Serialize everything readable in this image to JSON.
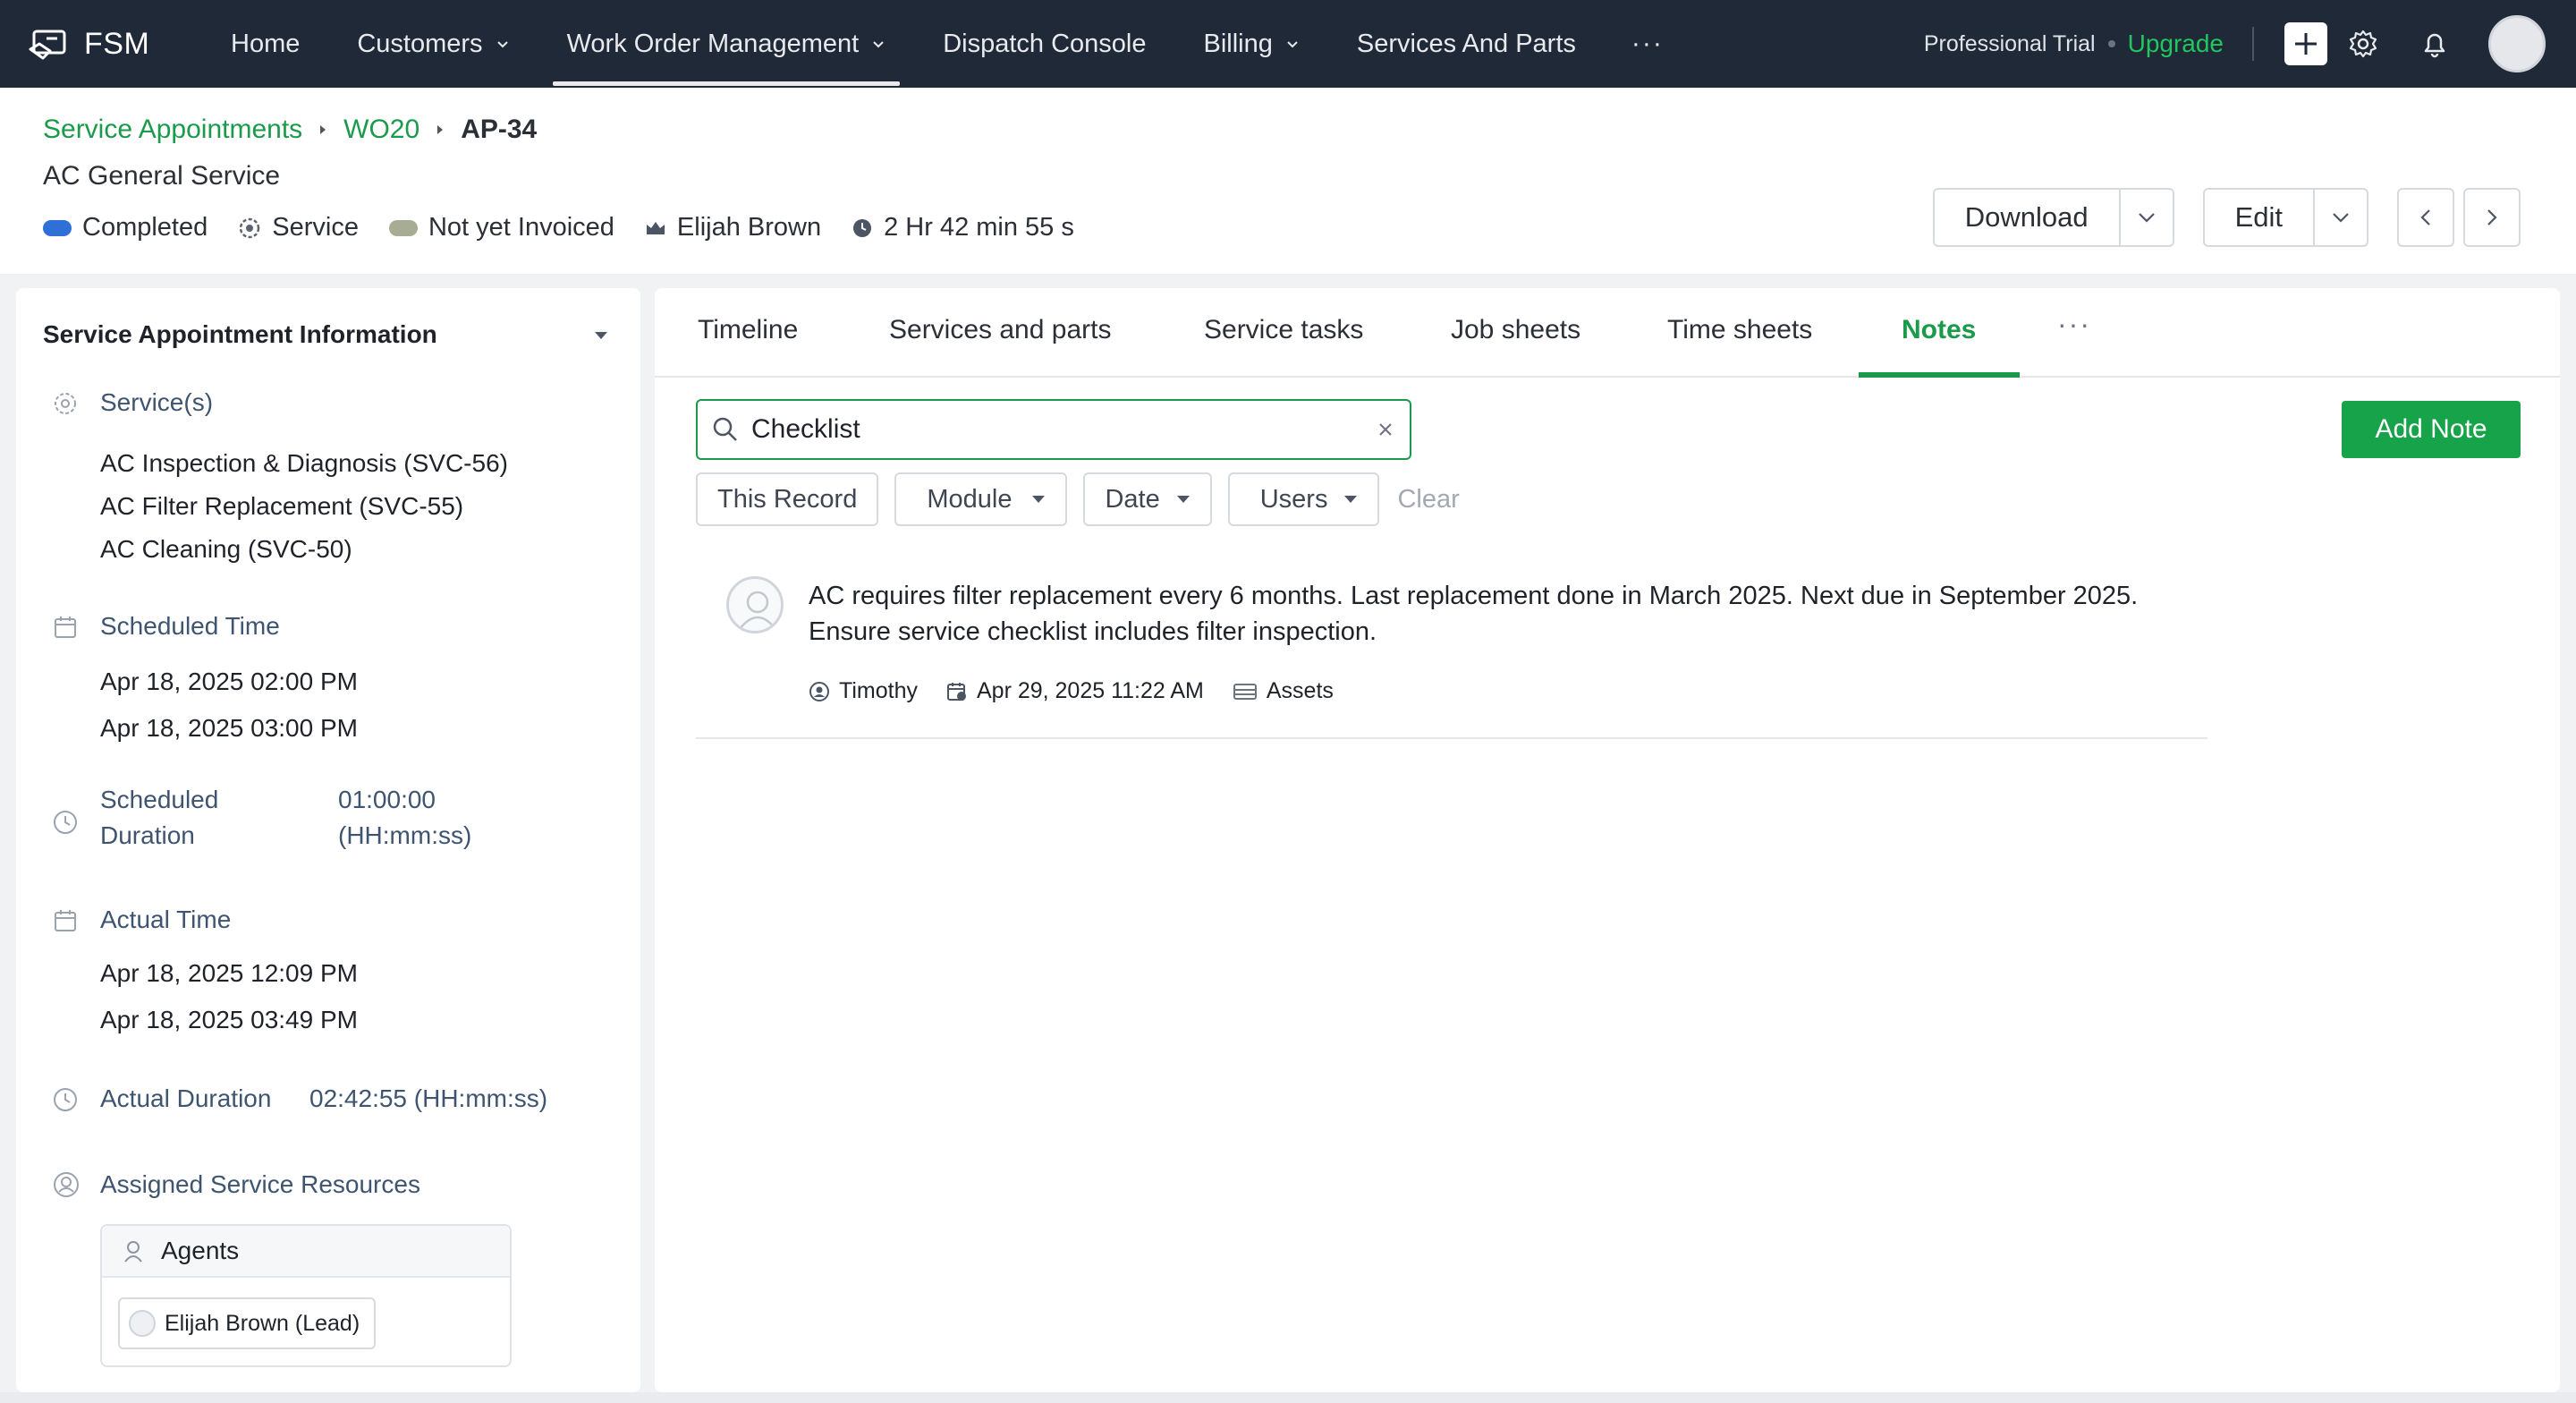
{
  "topnav": {
    "brand": "FSM",
    "items": [
      {
        "label": "Home"
      },
      {
        "label": "Customers"
      },
      {
        "label": "Work Order Management"
      },
      {
        "label": "Dispatch Console"
      },
      {
        "label": "Billing"
      },
      {
        "label": "Services And Parts"
      }
    ],
    "more": "···",
    "trial": "Professional Trial",
    "upgrade": "Upgrade"
  },
  "breadcrumb": {
    "items": [
      "Service Appointments",
      "WO20"
    ],
    "current": "AP-34"
  },
  "record": {
    "title": "AC General Service",
    "status": "Completed",
    "type": "Service",
    "invoice": "Not yet Invoiced",
    "owner": "Elijah Brown",
    "duration": "2 Hr 42 min 55 s"
  },
  "actions": {
    "download": "Download",
    "edit": "Edit"
  },
  "left_panel": {
    "title": "Service Appointment Information",
    "services_label": "Service(s)",
    "services": [
      "AC Inspection & Diagnosis (SVC-56)",
      "AC Filter Replacement (SVC-55)",
      "AC Cleaning (SVC-50)"
    ],
    "scheduled_time_label": "Scheduled Time",
    "scheduled_start": "Apr 18, 2025 02:00 PM",
    "scheduled_end": "Apr 18, 2025 03:00 PM",
    "scheduled_duration_label_1": "Scheduled",
    "scheduled_duration_label_2": "Duration",
    "scheduled_duration_1": "01:00:00",
    "scheduled_duration_2": "(HH:mm:ss)",
    "actual_time_label": "Actual Time",
    "actual_start": "Apr 18, 2025 12:09 PM",
    "actual_end": "Apr 18, 2025 03:49 PM",
    "actual_duration_label": "Actual Duration",
    "actual_duration": "02:42:55 (HH:mm:ss)",
    "resources_label": "Assigned Service Resources",
    "agents_title": "Agents",
    "agent_chip": "Elijah Brown (Lead)"
  },
  "tabs": [
    {
      "label": "Timeline"
    },
    {
      "label": "Services and parts"
    },
    {
      "label": "Service tasks"
    },
    {
      "label": "Job sheets"
    },
    {
      "label": "Time sheets"
    },
    {
      "label": "Notes"
    }
  ],
  "tabs_more": "···",
  "notes": {
    "search_value": "Checklist",
    "add_note": "Add Note",
    "filters": {
      "this_record": "This Record",
      "module": "Module",
      "date": "Date",
      "users": "Users",
      "clear": "Clear"
    },
    "items": [
      {
        "text_line1": "AC requires filter replacement every 6 months. Last replacement done in March 2025. Next due in September 2025.",
        "text_line2": "Ensure service checklist includes filter inspection.",
        "author": "Timothy",
        "timestamp": "Apr 29, 2025 11:22 AM",
        "module": "Assets"
      }
    ]
  },
  "colors": {
    "accent": "#1a9a4a",
    "nav_bg": "#1f2937",
    "completed": "#2f6fd6",
    "not_invoiced": "#a7ad95",
    "link": "#1a9a4a"
  }
}
